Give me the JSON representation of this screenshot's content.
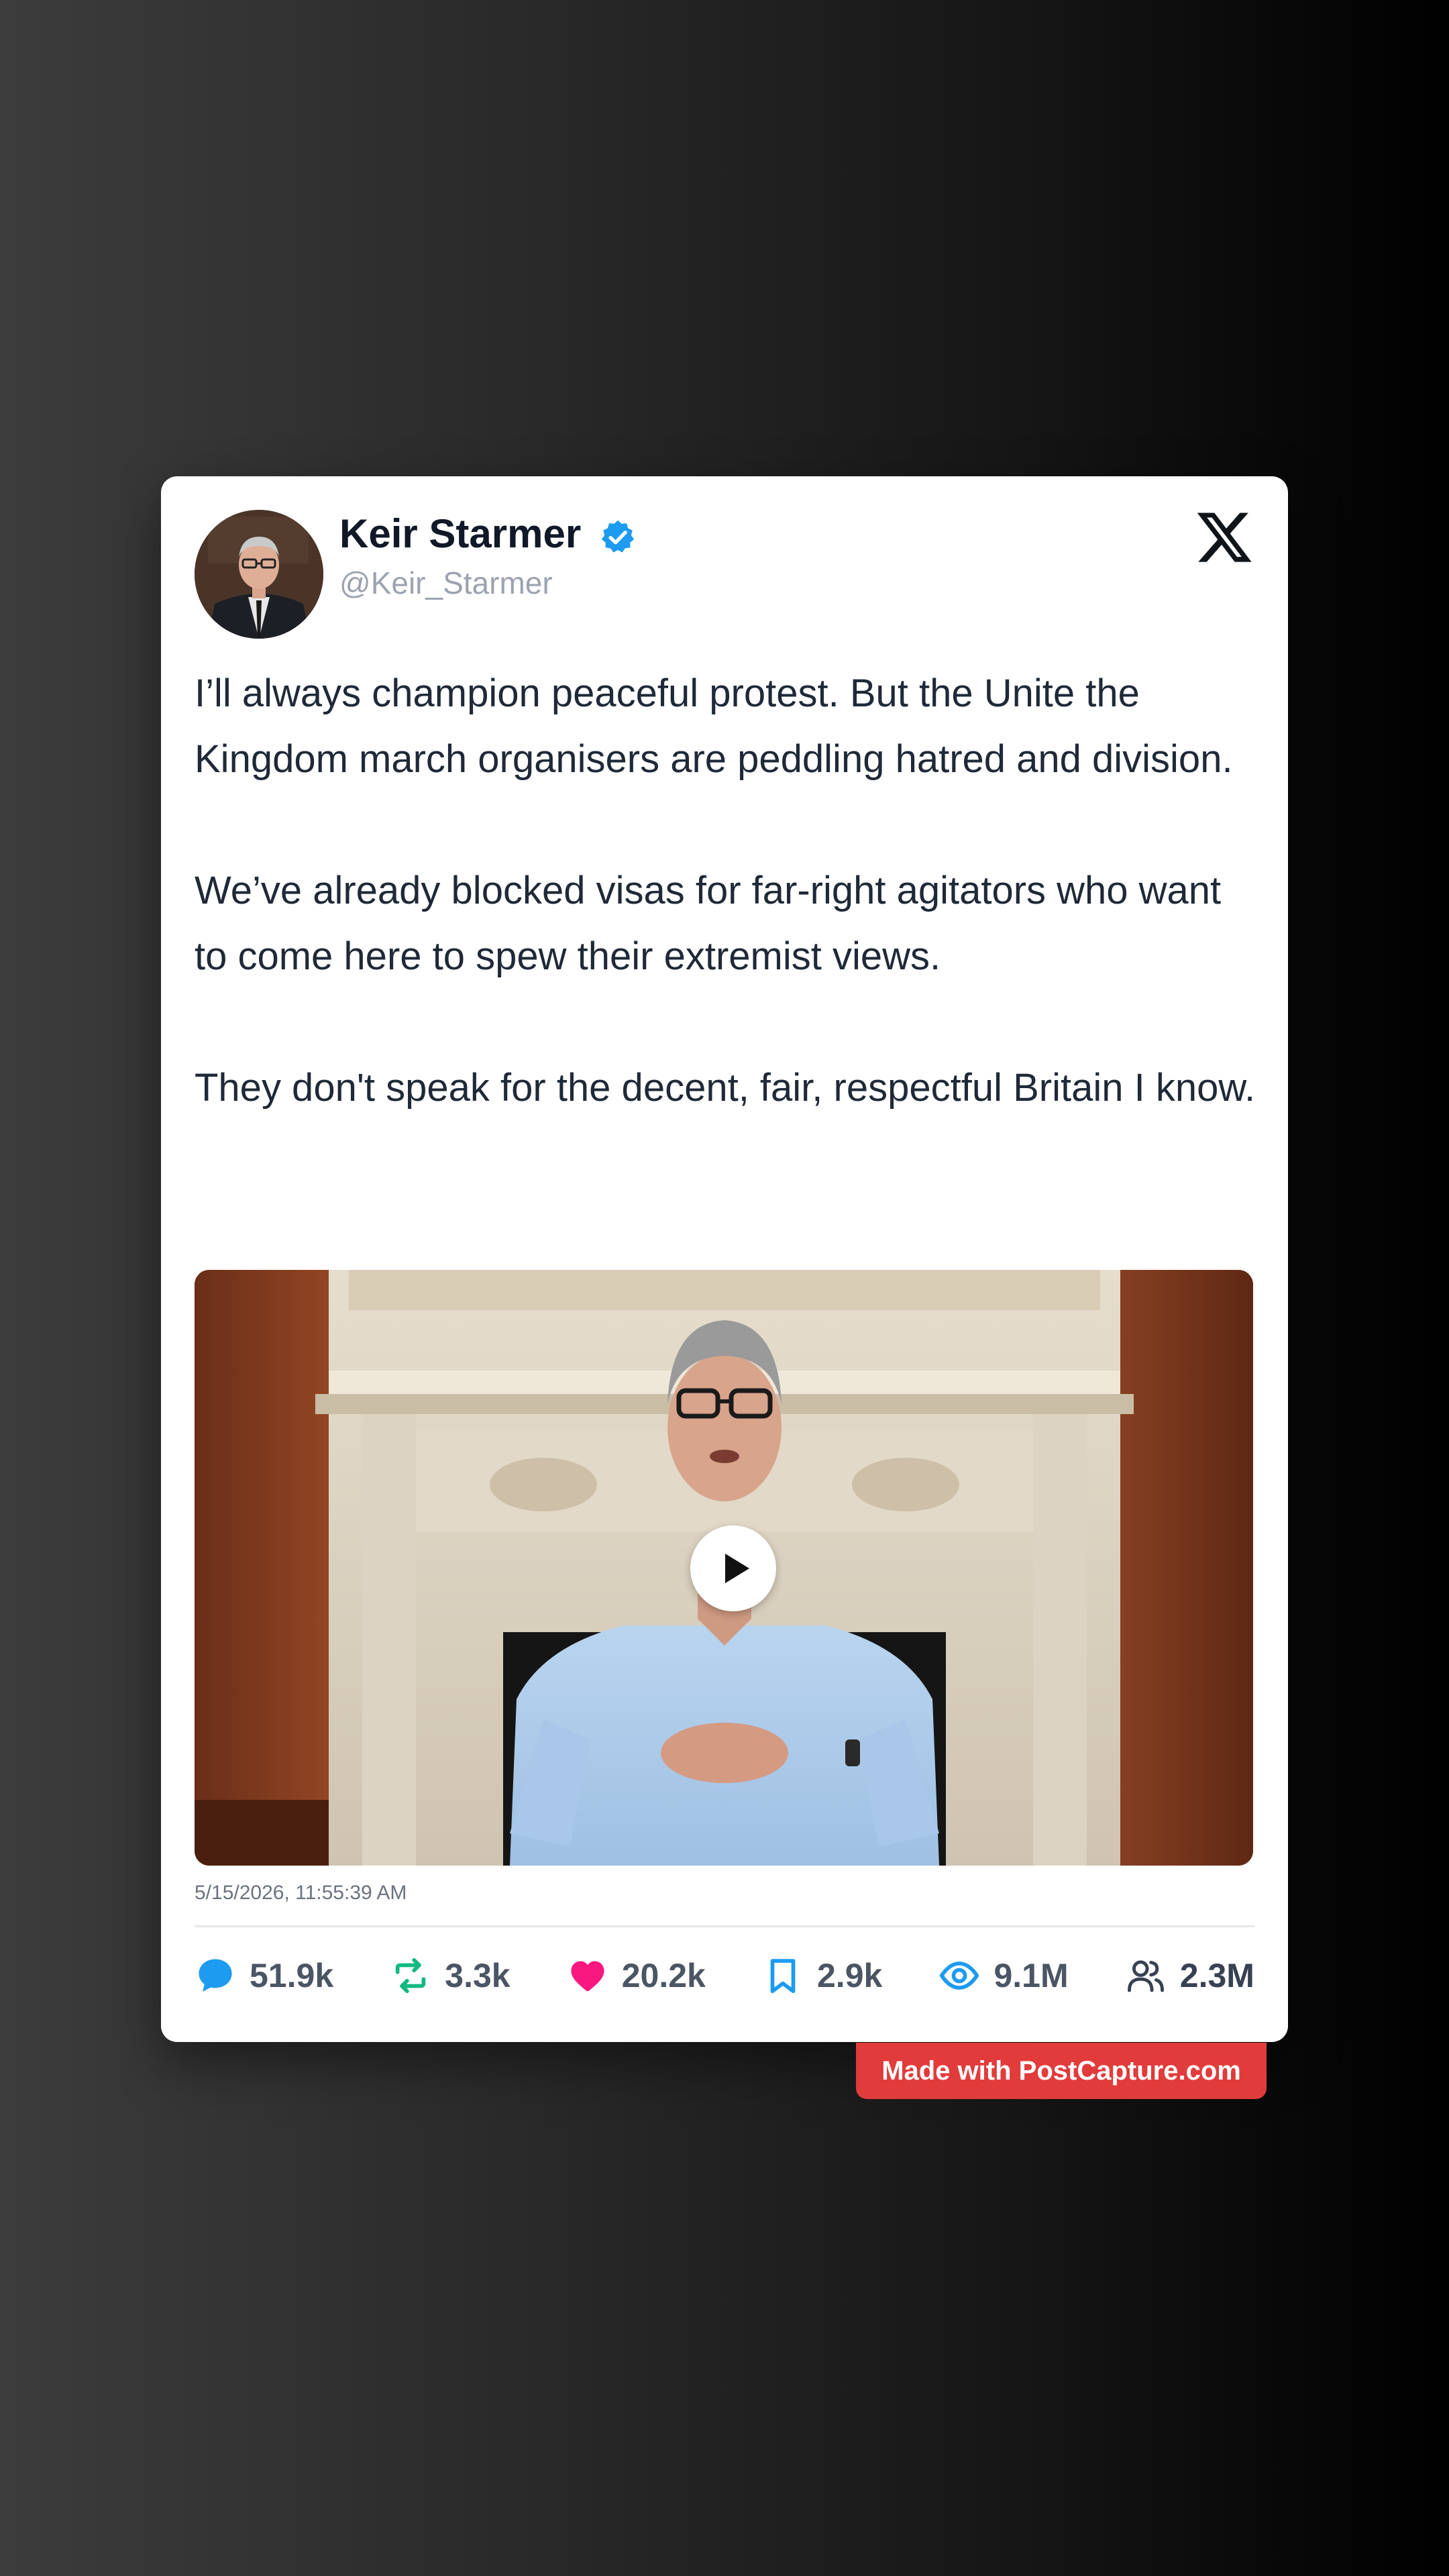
{
  "author": {
    "name": "Keir Starmer",
    "handle": "@Keir_Starmer"
  },
  "tweet": {
    "paragraphs": [
      "I’ll always champion peaceful protest. But the Unite the Kingdom march organisers are peddling hatred and division.",
      "We’ve already blocked visas for far-right agitators who want to come here to spew their extremist views.",
      "They don't speak for the decent, fair, respectful Britain I know."
    ],
    "timestamp": "5/15/2026, 11:55:39 AM"
  },
  "media": {
    "type": "video",
    "icon": "play-icon"
  },
  "stats": {
    "replies": "51.9k",
    "retweets": "3.3k",
    "likes": "20.2k",
    "bookmarks": "2.9k",
    "views": "9.1M",
    "followers": "2.3M"
  },
  "watermark": "Made with PostCapture.com",
  "colors": {
    "verified": "#1d9bf0",
    "reply": "#1d9bf0",
    "retweet": "#10b981",
    "like": "#f91880",
    "bookmark": "#1d9bf0",
    "views": "#1d9bf0",
    "badge": "#e23b3b"
  }
}
